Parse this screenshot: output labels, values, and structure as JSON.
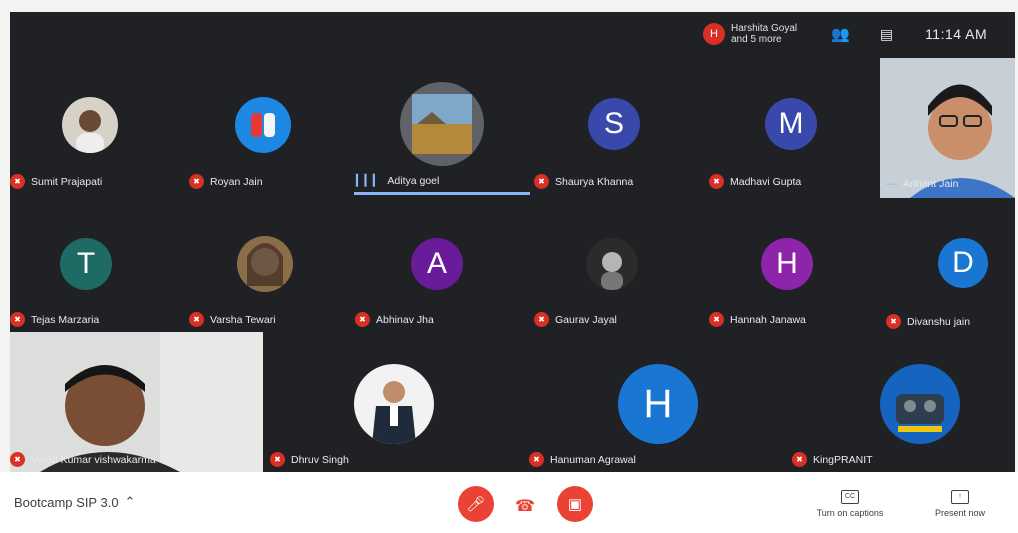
{
  "top_bar": {
    "viewer_initial": "H",
    "viewer_text_1": "Harshita Goyal",
    "viewer_text_2": "and 5 more",
    "people_icon": "people-icon",
    "chat_icon": "chat-icon",
    "time": "11:14 AM"
  },
  "participants": [
    {
      "name": "Sumit Prajapati",
      "initial": ""
    },
    {
      "name": "Royan Jain",
      "initial": ""
    },
    {
      "name": "Aditya goel",
      "initial": ""
    },
    {
      "name": "Shaurya Khanna",
      "initial": "S"
    },
    {
      "name": "Madhavi Gupta",
      "initial": "M"
    },
    {
      "name": "Arihant Jain",
      "initial": ""
    },
    {
      "name": "Tejas Marzaria",
      "initial": "T"
    },
    {
      "name": "Varsha Tewari",
      "initial": ""
    },
    {
      "name": "Abhinav Jha",
      "initial": "A"
    },
    {
      "name": "Gaurav Jayal",
      "initial": ""
    },
    {
      "name": "Hannah Janawa",
      "initial": "H"
    },
    {
      "name": "Divanshu jain",
      "initial": "D"
    },
    {
      "name": "Vinod Kumar vishwakarma",
      "initial": ""
    },
    {
      "name": "Dhruv Singh",
      "initial": ""
    },
    {
      "name": "Hanuman Agrawal",
      "initial": "H"
    },
    {
      "name": "KingPRANIT",
      "initial": ""
    }
  ],
  "toolbar": {
    "meeting_title": "Bootcamp SIP 3.0",
    "captions_label": "Turn on captions",
    "present_label": "Present now"
  },
  "colors": {
    "background": "#202124",
    "muted_red": "#d93025",
    "speaking_blue": "#8ab4f8",
    "avatar_teal": "#1e6b64",
    "avatar_indigo": "#3949ab",
    "avatar_purple": "#8e24aa",
    "avatar_blue": "#1976d2"
  }
}
